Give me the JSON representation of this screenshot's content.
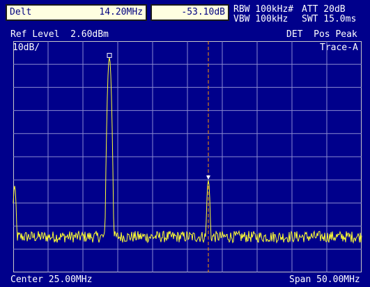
{
  "header": {
    "mode_label": "Delt",
    "delta_freq": "14.20MHz",
    "delta_level": "-53.10dB",
    "rbw": "RBW 100kHz#",
    "vbw": "VBW 100kHz",
    "att": "ATT 20dB",
    "swt": "SWT 15.0ms"
  },
  "status": {
    "ref_level": "Ref Level  2.60dBm",
    "det": "DET  Pos Peak",
    "scale": "10dB/",
    "trace": "Trace-A"
  },
  "footer": {
    "center": "Center 25.00MHz",
    "span": "Span 50.00MHz"
  },
  "colors": {
    "background": "#00008b",
    "grid": "#8a8ad0",
    "trace": "#ffff33",
    "marker_line": "#ff9900",
    "header_box": "#ffffe0"
  },
  "chart_data": {
    "type": "line",
    "x_range_mhz": [
      0,
      50
    ],
    "y_range_dbm": [
      -97.4,
      2.6
    ],
    "divisions": {
      "x": 10,
      "y": 10
    },
    "grid": true,
    "noise_floor_dbm": -82,
    "peaks": [
      {
        "freq_mhz": 0.2,
        "level_dbm": -60
      },
      {
        "freq_mhz": 13.8,
        "level_dbm": -4.5
      },
      {
        "freq_mhz": 28.0,
        "level_dbm": -57.6
      }
    ],
    "markers": [
      {
        "type": "reference",
        "symbol": "square",
        "freq_mhz": 13.8,
        "level_dbm": -4.5
      },
      {
        "type": "delta",
        "symbol": "triangle-down",
        "freq_mhz": 28.0,
        "level_dbm": -57.6
      }
    ],
    "display_line_mhz": 28.0
  }
}
